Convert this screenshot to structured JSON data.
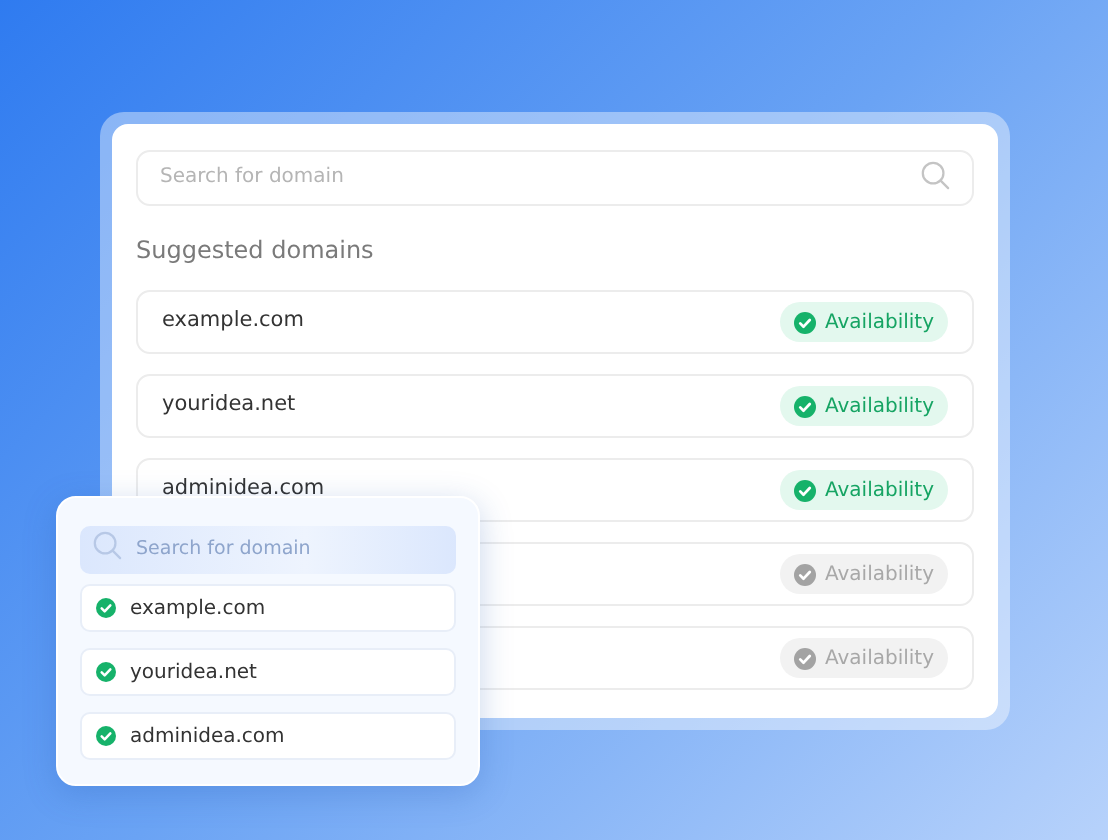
{
  "main_panel": {
    "search": {
      "placeholder": "Search for domain"
    },
    "heading": "Suggested domains",
    "rows": [
      {
        "name": "example.com",
        "badge": "Availability",
        "available": true
      },
      {
        "name": "youridea.net",
        "badge": "Availability",
        "available": true
      },
      {
        "name": "adminidea.com",
        "badge": "Availability",
        "available": true
      },
      {
        "badge": "Availability",
        "available": false
      },
      {
        "badge": "Availability",
        "available": false
      }
    ]
  },
  "popup": {
    "search": {
      "placeholder": "Search for domain"
    },
    "items": [
      {
        "name": "example.com",
        "available": true
      },
      {
        "name": "youridea.net",
        "available": true
      },
      {
        "name": "adminidea.com",
        "available": true
      }
    ]
  }
}
